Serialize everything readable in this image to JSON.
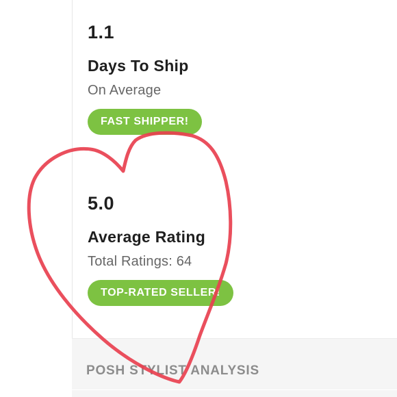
{
  "stats": {
    "shipping": {
      "value": "1.1",
      "title": "Days To Ship",
      "subtitle": "On Average",
      "badge": "FAST SHIPPER!"
    },
    "rating": {
      "value": "5.0",
      "title": "Average Rating",
      "subtitle": "Total Ratings: 64",
      "badge": "TOP-RATED SELLER!"
    }
  },
  "analysis": {
    "title": "POSH STYLIST ANALYSIS"
  },
  "colors": {
    "badge_green": "#7dc242",
    "heart_stroke": "#e8404f",
    "text_dark": "#1f1f1f",
    "text_muted": "#666666"
  },
  "icons": {
    "overlay": "heart-drawing"
  }
}
